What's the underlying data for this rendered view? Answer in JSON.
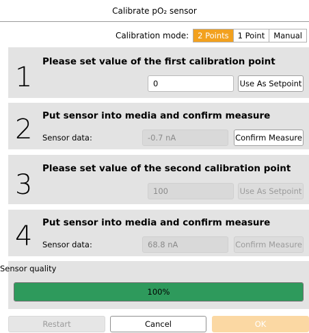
{
  "window": {
    "title": "Calibrate pO₂ sensor"
  },
  "mode": {
    "label": "Calibration mode:",
    "options": [
      "2 Points",
      "1 Point",
      "Manual"
    ],
    "selected": "2 Points"
  },
  "steps": [
    {
      "number": "1",
      "title": "Please set value of the first calibration point",
      "input_value": "0",
      "button": "Use As Setpoint"
    },
    {
      "number": "2",
      "title": "Put sensor into media and confirm measure",
      "sensor_label": "Sensor data:",
      "value": "-0.7 nA",
      "button": "Confirm Measure"
    },
    {
      "number": "3",
      "title": "Please set value of the second calibration point",
      "input_value": "100",
      "button": "Use As Setpoint"
    },
    {
      "number": "4",
      "title": "Put sensor into media and confirm measure",
      "sensor_label": "Sensor data:",
      "value": "68.8 nA",
      "button": "Confirm Measure"
    }
  ],
  "quality": {
    "label": "Sensor quality",
    "percent": 100,
    "text": "100%",
    "color": "#2e9a5c"
  },
  "footer": {
    "restart": "Restart",
    "cancel": "Cancel",
    "ok": "OK"
  },
  "colors": {
    "accent": "#f2a11f",
    "panel": "#e3e3e3"
  }
}
